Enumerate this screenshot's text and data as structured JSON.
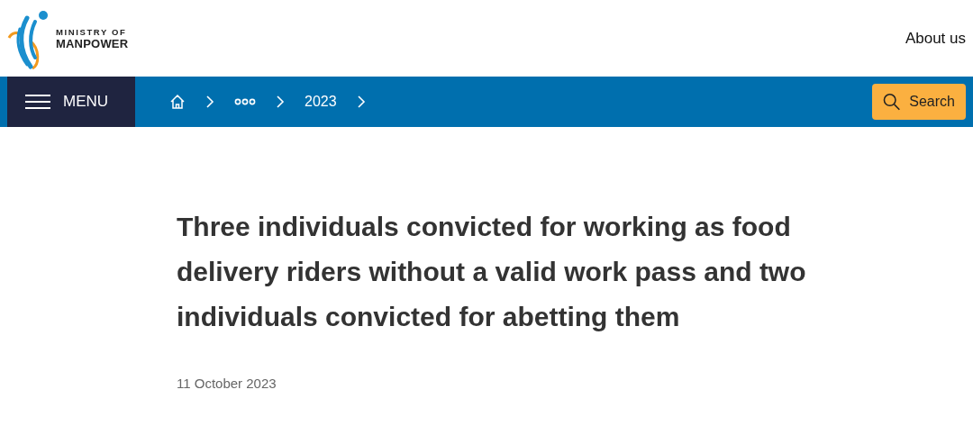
{
  "header": {
    "logo": {
      "line_1": "MINISTRY OF",
      "line_2": "MANPOWER"
    },
    "link": "About us"
  },
  "navbar": {
    "menu": "MENU",
    "breadcrumb": [
      {
        "kind": "home"
      },
      {
        "kind": "more"
      },
      {
        "kind": "text",
        "label": "2023"
      }
    ],
    "search": "Search"
  },
  "article": {
    "title": "Three individuals convicted for working as food delivery riders without a valid work pass and two individuals convicted for abetting them",
    "date": "11 October 2023"
  }
}
